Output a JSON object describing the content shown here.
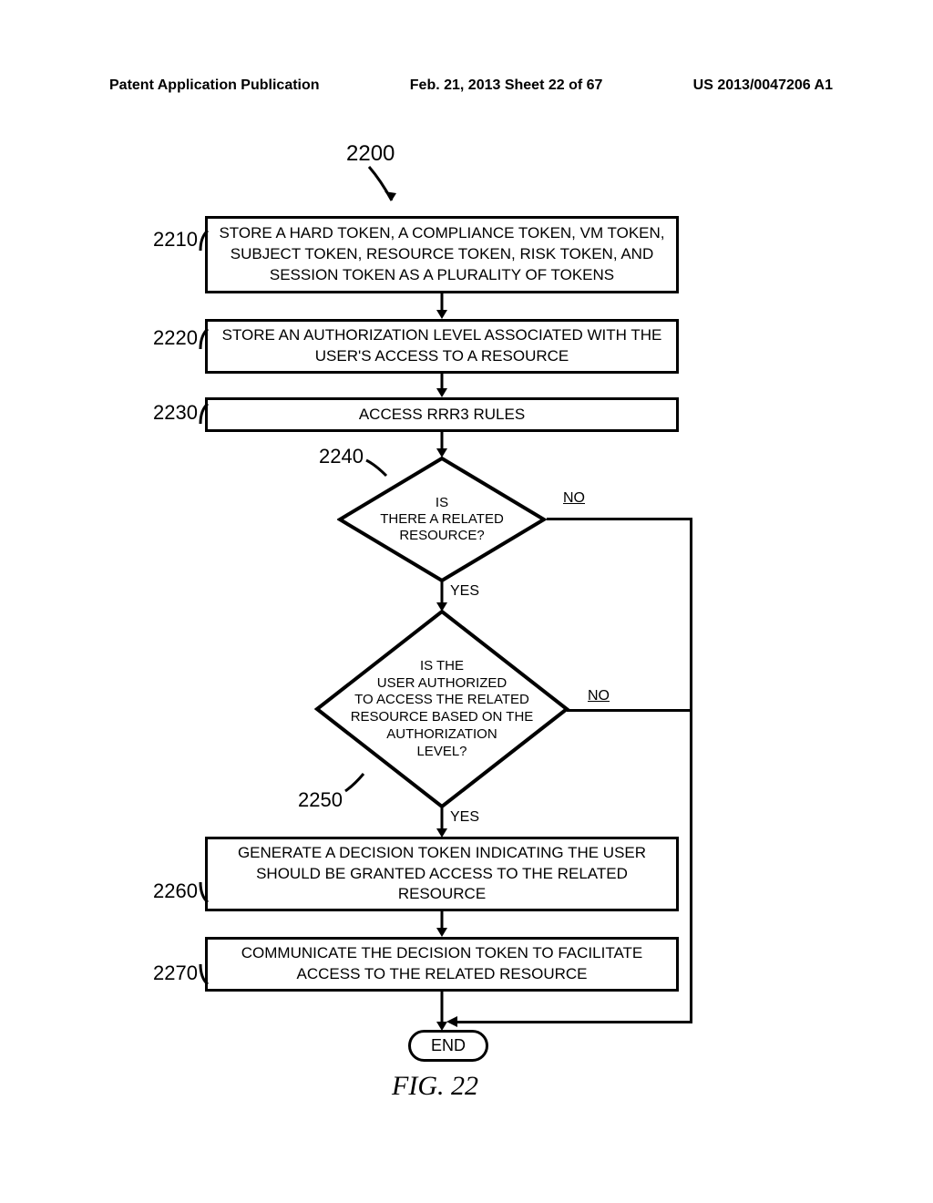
{
  "header": {
    "left": "Patent Application Publication",
    "center": "Feb. 21, 2013  Sheet 22 of 67",
    "right": "US 2013/0047206 A1"
  },
  "figure_ref_top": "2200",
  "refs": {
    "r1": "2210",
    "r2": "2220",
    "r3": "2230",
    "d1": "2240",
    "d2": "2250",
    "r4": "2260",
    "r5": "2270"
  },
  "boxes": {
    "b1": "STORE A HARD TOKEN, A COMPLIANCE TOKEN, VM TOKEN, SUBJECT TOKEN, RESOURCE TOKEN, RISK TOKEN, AND SESSION TOKEN AS A PLURALITY OF TOKENS",
    "b2": "STORE AN AUTHORIZATION LEVEL ASSOCIATED WITH THE USER'S ACCESS TO A RESOURCE",
    "b3": "ACCESS RRR3 RULES",
    "b4": "GENERATE A DECISION TOKEN INDICATING THE USER SHOULD BE GRANTED ACCESS TO THE RELATED RESOURCE",
    "b5": "COMMUNICATE THE DECISION TOKEN TO FACILITATE ACCESS TO THE RELATED RESOURCE"
  },
  "diamonds": {
    "d1": "IS\nTHERE A RELATED\nRESOURCE?",
    "d2": "IS THE\nUSER AUTHORIZED\nTO ACCESS THE RELATED\nRESOURCE BASED ON THE\nAUTHORIZATION\nLEVEL?"
  },
  "labels": {
    "no": "NO",
    "yes": "YES"
  },
  "end": "END",
  "caption": "FIG. 22"
}
